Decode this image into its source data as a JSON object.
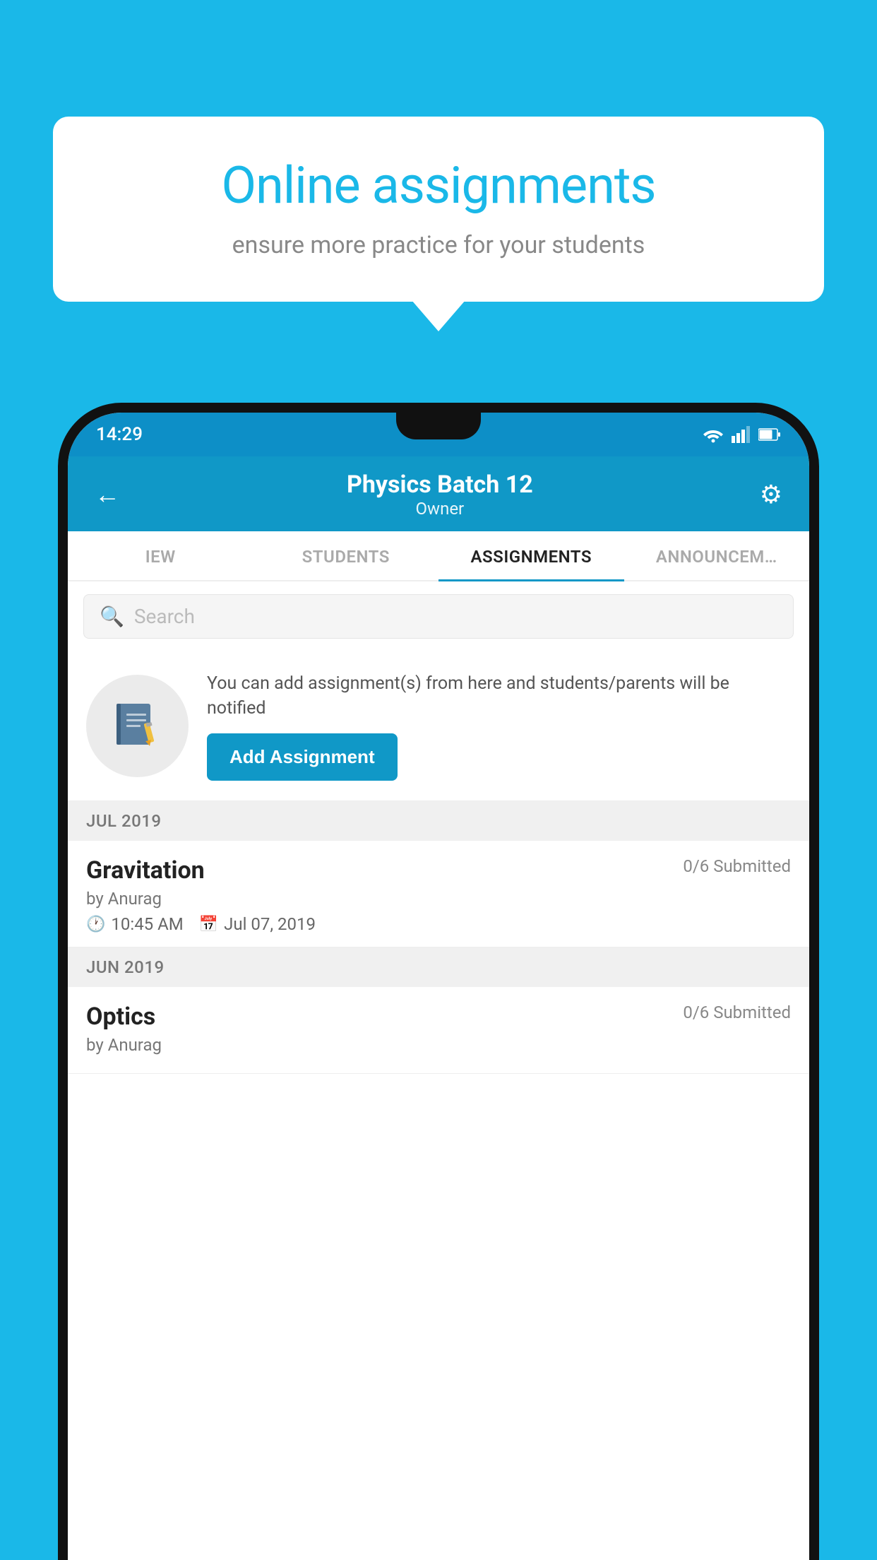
{
  "background_color": "#1ab8e8",
  "speech_bubble": {
    "title": "Online assignments",
    "subtitle": "ensure more practice for your students"
  },
  "status_bar": {
    "time": "14:29"
  },
  "app_header": {
    "title": "Physics Batch 12",
    "subtitle": "Owner",
    "back_label": "←",
    "settings_label": "⚙"
  },
  "tabs": [
    {
      "label": "IEW",
      "active": false
    },
    {
      "label": "STUDENTS",
      "active": false
    },
    {
      "label": "ASSIGNMENTS",
      "active": true
    },
    {
      "label": "ANNOUNCEM…",
      "active": false
    }
  ],
  "search": {
    "placeholder": "Search"
  },
  "promo": {
    "text": "You can add assignment(s) from here and students/parents will be notified",
    "button_label": "Add Assignment"
  },
  "sections": [
    {
      "header": "JUL 2019",
      "assignments": [
        {
          "title": "Gravitation",
          "submitted": "0/6 Submitted",
          "by": "by Anurag",
          "time": "10:45 AM",
          "date": "Jul 07, 2019"
        }
      ]
    },
    {
      "header": "JUN 2019",
      "assignments": [
        {
          "title": "Optics",
          "submitted": "0/6 Submitted",
          "by": "by Anurag",
          "time": "",
          "date": ""
        }
      ]
    }
  ]
}
